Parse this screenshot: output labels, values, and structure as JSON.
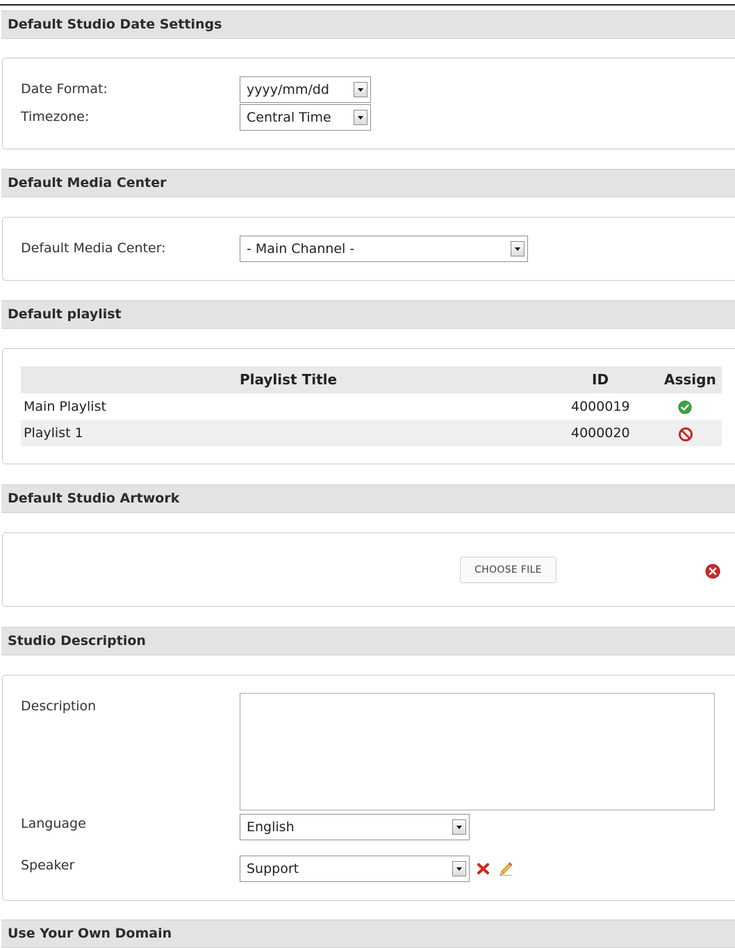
{
  "date_settings": {
    "header": "Default Studio Date Settings",
    "date_format_label": "Date Format:",
    "date_format_value": "yyyy/mm/dd",
    "timezone_label": "Timezone:",
    "timezone_value": "Central Time"
  },
  "media_center": {
    "header": "Default Media Center",
    "label": "Default Media Center:",
    "value": "- Main Channel -"
  },
  "playlist": {
    "header": "Default playlist",
    "columns": [
      "Playlist Title",
      "ID",
      "Assign"
    ],
    "rows": [
      {
        "title": "Main Playlist",
        "id": "4000019",
        "assign_icon": "check-circle-icon"
      },
      {
        "title": "Playlist 1",
        "id": "4000020",
        "assign_icon": "prohibited-icon"
      }
    ]
  },
  "artwork": {
    "header": "Default Studio Artwork",
    "choose_file_label": "CHOOSE FILE",
    "remove_icon": "remove-circle-icon"
  },
  "description": {
    "header": "Studio Description",
    "description_label": "Description",
    "description_value": "",
    "language_label": "Language",
    "language_value": "English",
    "speaker_label": "Speaker",
    "speaker_value": "Support",
    "speaker_icons": [
      "delete-x-icon",
      "pencil-icon"
    ]
  },
  "domain": {
    "header": "Use Your Own Domain"
  }
}
